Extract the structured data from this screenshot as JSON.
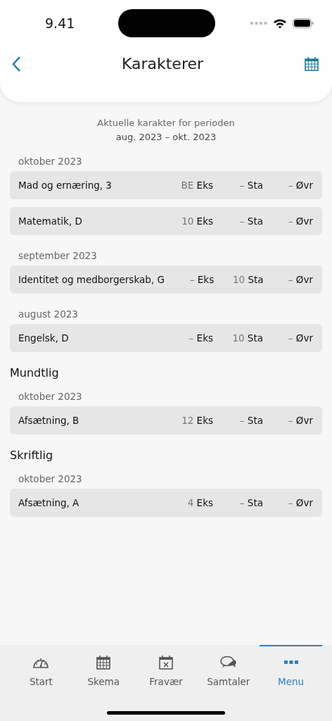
{
  "status_bar": {
    "time": "9.41"
  },
  "header": {
    "title": "Karakterer"
  },
  "period": {
    "line_1": "Aktuelle karakter for perioden",
    "line_2": "aug. 2023 – okt. 2023"
  },
  "sections": [
    {
      "months": [
        {
          "label": "oktober 2023",
          "rows": [
            {
              "name": "Mad og ernæring, 3",
              "grades": [
                {
                  "value": "BE",
                  "label": "Eks"
                },
                {
                  "value": "–",
                  "label": "Sta"
                },
                {
                  "value": "–",
                  "label": "Øvr"
                }
              ]
            },
            {
              "name": "Matematik, D",
              "grades": [
                {
                  "value": "10",
                  "label": "Eks"
                },
                {
                  "value": "–",
                  "label": "Sta"
                },
                {
                  "value": "–",
                  "label": "Øvr"
                }
              ]
            }
          ]
        },
        {
          "label": "september 2023",
          "rows": [
            {
              "name": "Identitet og medborgerskab, G",
              "grades": [
                {
                  "value": "–",
                  "label": "Eks"
                },
                {
                  "value": "10",
                  "label": "Sta"
                },
                {
                  "value": "–",
                  "label": "Øvr"
                }
              ]
            }
          ]
        },
        {
          "label": "august 2023",
          "rows": [
            {
              "name": "Engelsk, D",
              "grades": [
                {
                  "value": "–",
                  "label": "Eks"
                },
                {
                  "value": "10",
                  "label": "Sta"
                },
                {
                  "value": "–",
                  "label": "Øvr"
                }
              ]
            }
          ]
        }
      ]
    },
    {
      "title": "Mundtlig",
      "months": [
        {
          "label": "oktober 2023",
          "rows": [
            {
              "name": "Afsætning, B",
              "grades": [
                {
                  "value": "12",
                  "label": "Eks"
                },
                {
                  "value": "–",
                  "label": "Sta"
                },
                {
                  "value": "–",
                  "label": "Øvr"
                }
              ]
            }
          ]
        }
      ]
    },
    {
      "title": "Skriftlig",
      "months": [
        {
          "label": "oktober 2023",
          "rows": [
            {
              "name": "Afsætning, A",
              "grades": [
                {
                  "value": "4",
                  "label": "Eks"
                },
                {
                  "value": "–",
                  "label": "Sta"
                },
                {
                  "value": "–",
                  "label": "Øvr"
                }
              ]
            }
          ]
        }
      ]
    }
  ],
  "tab_bar": [
    {
      "kind": "gauge",
      "label": "Start",
      "selected": false
    },
    {
      "kind": "calendar",
      "label": "Skema",
      "selected": false
    },
    {
      "kind": "absence",
      "label": "Fravær",
      "selected": false
    },
    {
      "kind": "chat",
      "label": "Samtaler",
      "selected": false
    },
    {
      "kind": "dots",
      "label": "Menu",
      "selected": true
    }
  ]
}
